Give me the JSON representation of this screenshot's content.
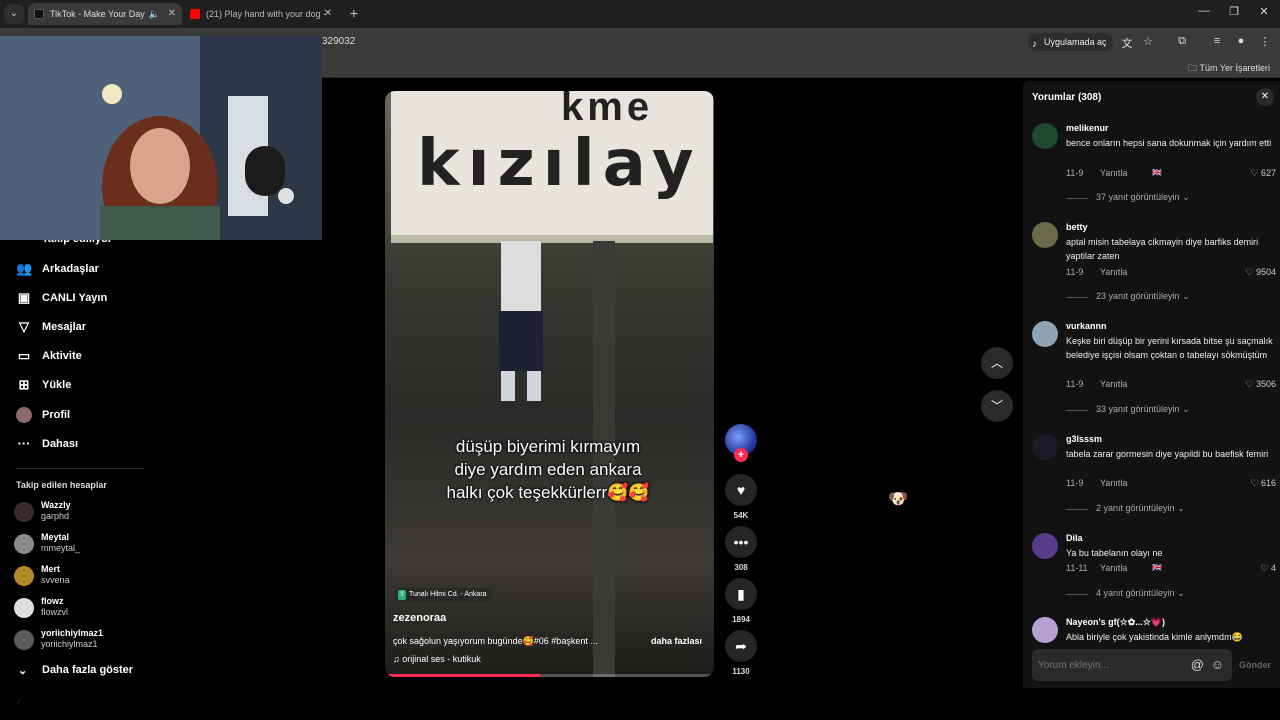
{
  "browser": {
    "tabs": [
      {
        "label": "TikTok - Make Your Day",
        "active": true,
        "favicon_color": "#111111"
      },
      {
        "label": "(21) Play hand with your dog -",
        "active": false,
        "favicon_color": "#ff0000"
      }
    ],
    "url": "329032",
    "open_in_app": "Uygulamada aç",
    "all_bookmarks": "Tüm Yer İşaretleri"
  },
  "sidebar": {
    "partial_item": "Takip ediliyor",
    "items": [
      {
        "label": "Arkadaşlar",
        "icon": "friends-icon"
      },
      {
        "label": "CANLI Yayın",
        "icon": "live-icon"
      },
      {
        "label": "Mesajlar",
        "icon": "messages-icon"
      },
      {
        "label": "Aktivite",
        "icon": "activity-icon"
      },
      {
        "label": "Yükle",
        "icon": "upload-icon"
      },
      {
        "label": "Profil",
        "icon": "profile-icon"
      },
      {
        "label": "Dahası",
        "icon": "more-icon"
      }
    ],
    "followed_title": "Takip edilen hesaplar",
    "followed": [
      {
        "name": "Wazzly",
        "handle": "garphd"
      },
      {
        "name": "Meytal",
        "handle": "mmeytal_"
      },
      {
        "name": "Mert",
        "handle": "svvena"
      },
      {
        "name": "flowz",
        "handle": "flowzvl"
      },
      {
        "name": "yoriichiylmaz1",
        "handle": "yoriichiylmaz1"
      }
    ],
    "show_more": "Daha fazla göster"
  },
  "video": {
    "sign_text": "kızılay",
    "sign_top": "kme",
    "caption_line1": "düşüp biyerimi kırmayım",
    "caption_line2": "diye yardım eden ankara",
    "caption_line3": "halkı çok teşekkürlerr🥰🥰",
    "location": "Tunalı Hilmi Cd. - Ankara",
    "author": "zezenoraa",
    "description": "çok sağolun yaşıyorum bugünde🥰#06 #başkent ...",
    "more": "daha fazlası",
    "sound": "orijinal ses - kutikuk",
    "progress": 0.47
  },
  "actions": {
    "likes": "54K",
    "comments": "308",
    "saves": "1894",
    "shares": "1130"
  },
  "comments_panel": {
    "title": "Yorumlar (308)",
    "input_placeholder": "Yorum ekleyin...",
    "send": "Gönder",
    "comments": [
      {
        "user": "melikenur",
        "text": "bence onların hepsi sana dokunmak için yardım etti",
        "date": "11-9",
        "reply": "Yanıtla",
        "likes": "627",
        "views": "37 yanıt görüntüleyin",
        "avatar_color": "#1e4a2e",
        "flag": true
      },
      {
        "user": "betty",
        "text": "aptal misin tabelaya cikmayin diye barfiks demiri yaptilar zaten",
        "date": "11-9",
        "reply": "Yanıtla",
        "likes": "9504",
        "views": "23 yanıt görüntüleyin",
        "avatar_color": "#6b6b4a",
        "flag": false
      },
      {
        "user": "vurkannn",
        "text": "Keşke biri düşüp bir yerini kırsada bitse şu saçmalık belediye işçisi olsam çoktan o tabelayı sökmüştüm",
        "date": "11-9",
        "reply": "Yanıtla",
        "likes": "3506",
        "views": "33 yanıt görüntüleyin",
        "avatar_color": "#8fa3b5",
        "flag": false
      },
      {
        "user": "g3lsssm",
        "text": "tabela zarar gormesin diye yapildi bu baefisk femiri",
        "date": "11-9",
        "reply": "Yanıtla",
        "likes": "616",
        "views": "2 yanıt görüntüleyin",
        "avatar_color": "#1a1a2a",
        "flag": false
      },
      {
        "user": "Dila",
        "text": "Ya bu tabelanın olayı ne",
        "date": "11-11",
        "reply": "Yanıtla",
        "likes": "4",
        "views": "4 yanıt görüntüleyin",
        "avatar_color": "#5a3a8a",
        "flag": true
      },
      {
        "user": "Nayeon's gf(☆✿...☆💗)",
        "text": "Abla biriyle çok yakistinda kimle anlymdm😂",
        "date": "",
        "reply": "",
        "likes": "",
        "views": "",
        "avatar_color": "#b6a0d4",
        "flag": false
      }
    ]
  },
  "colors": {
    "accent": "#fe2c55",
    "panel_bg": "#121212"
  }
}
